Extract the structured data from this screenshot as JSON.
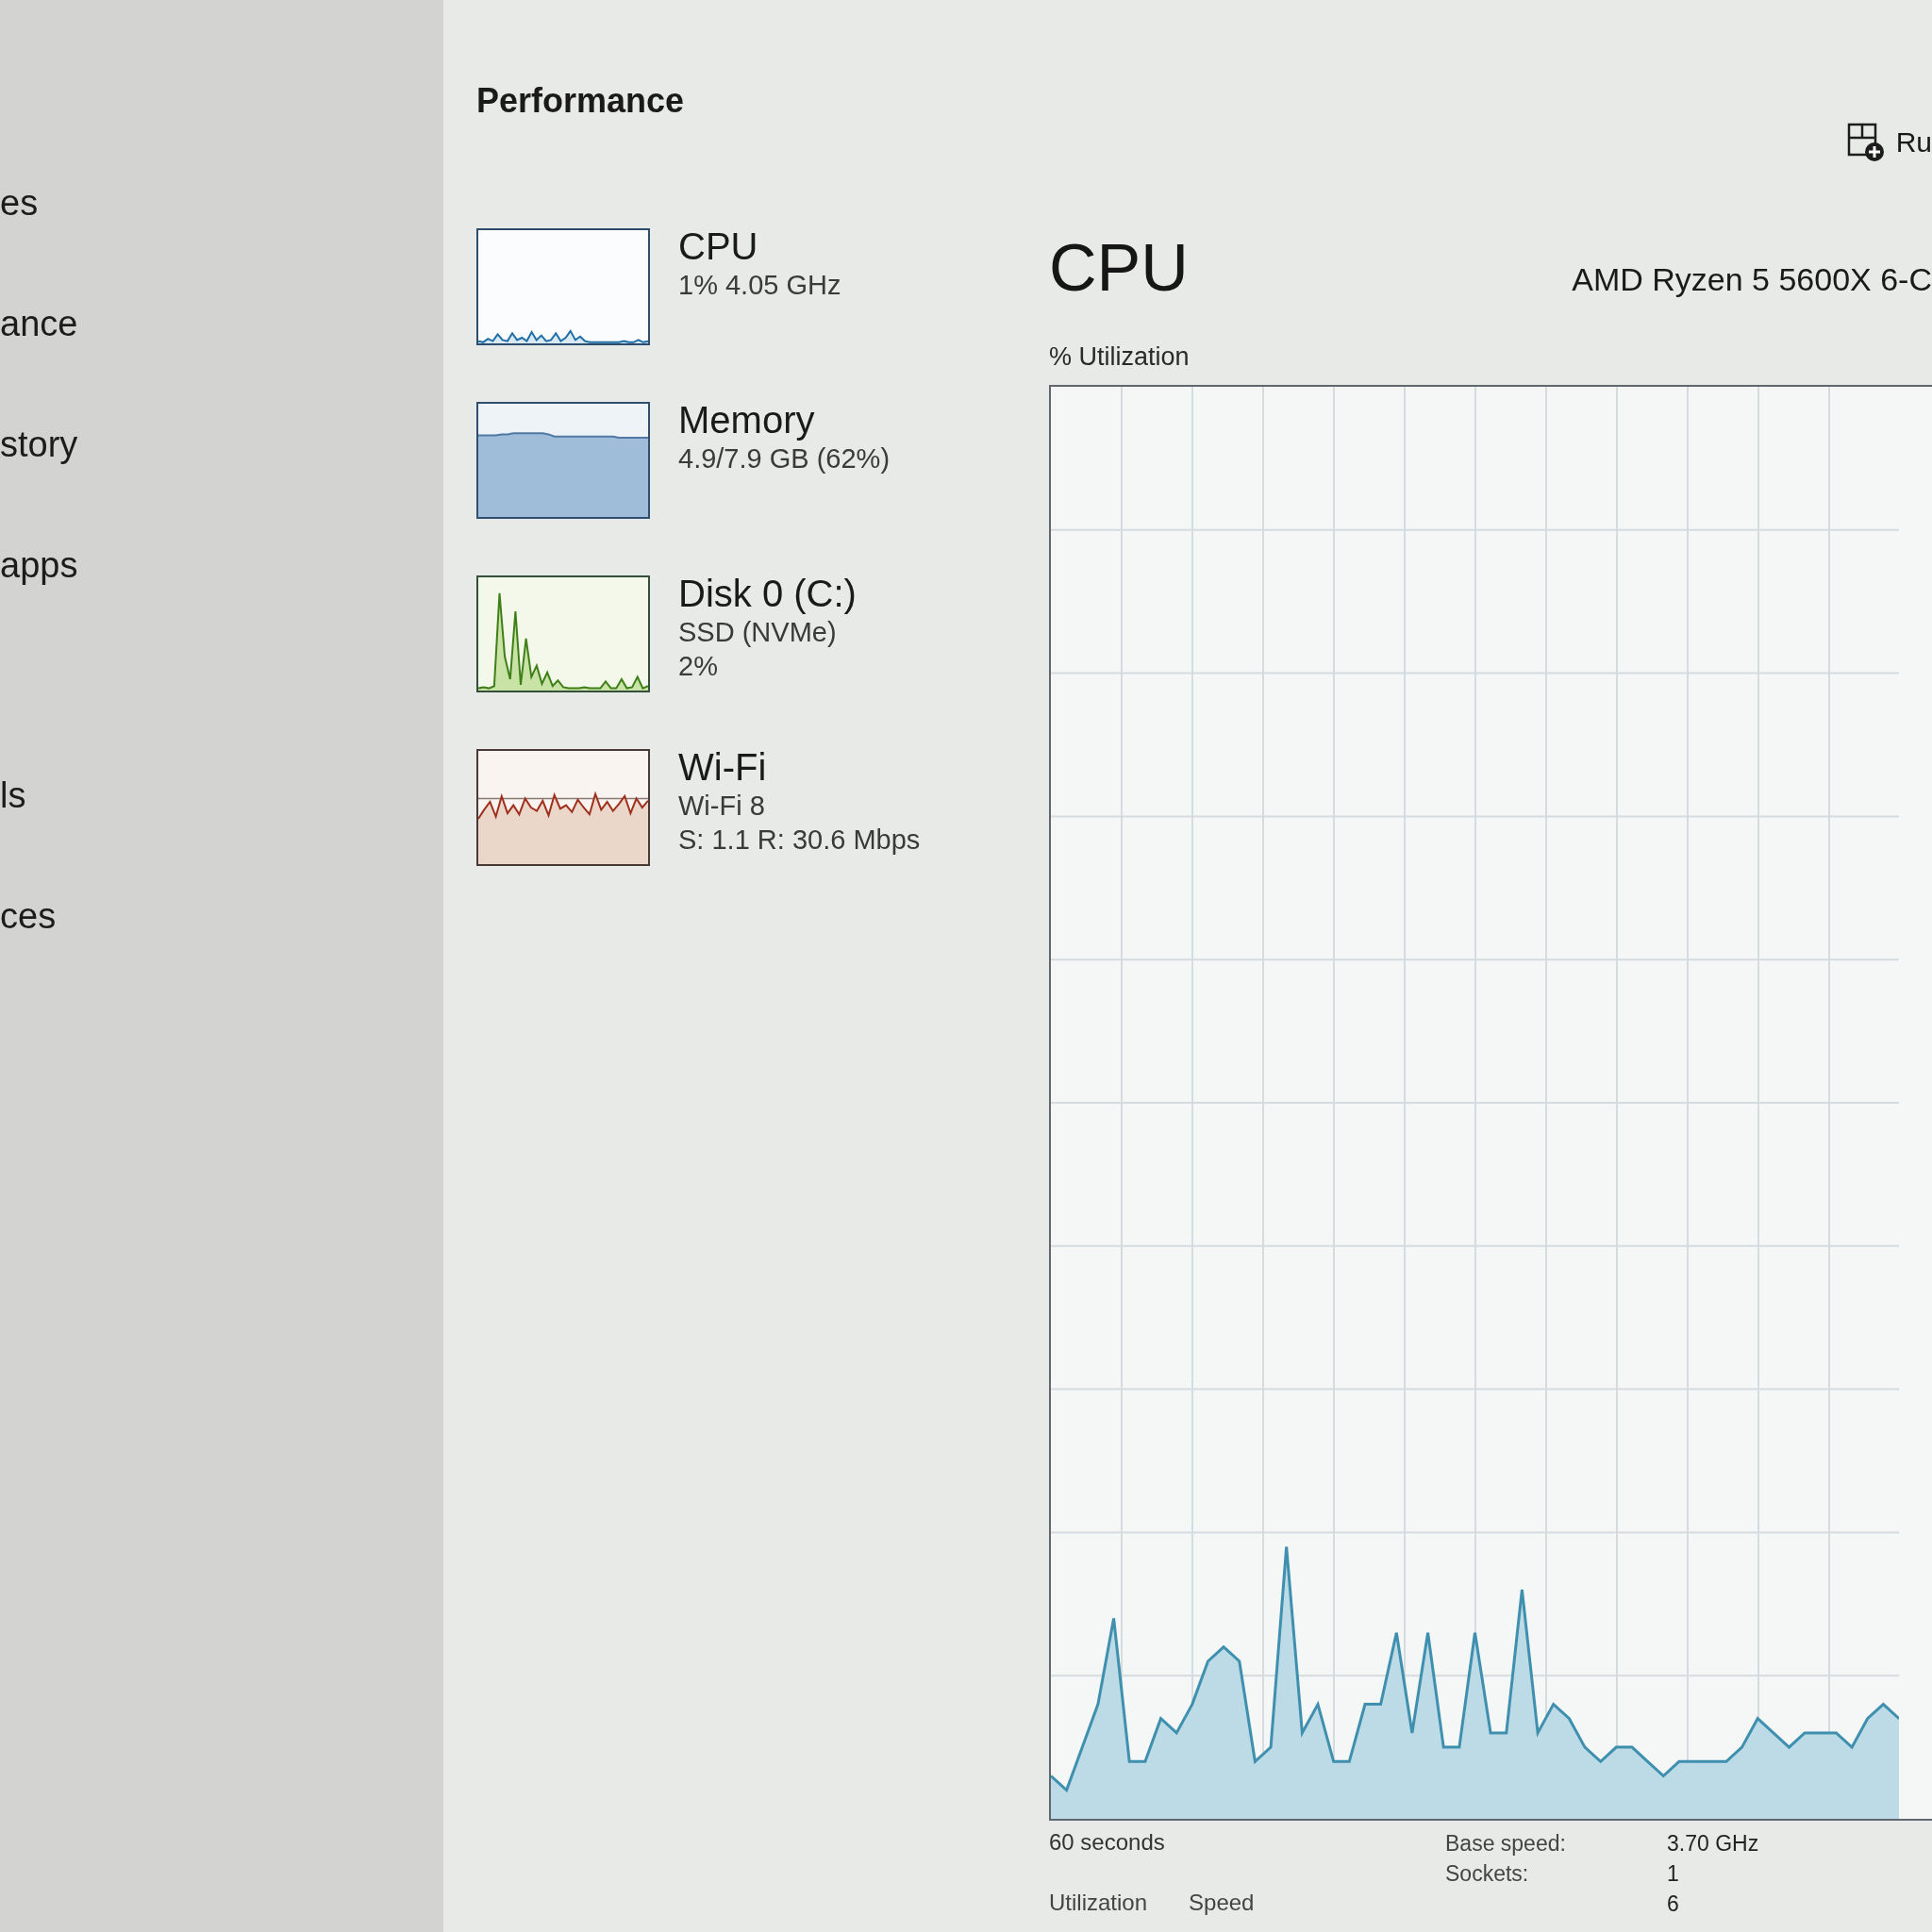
{
  "sidebar": {
    "items": [
      {
        "label": "es"
      },
      {
        "label": "ance"
      },
      {
        "label": "story"
      },
      {
        "label": "apps"
      },
      {
        "label": "ls"
      },
      {
        "label": "ces"
      }
    ]
  },
  "header": {
    "title": "Performance",
    "toolbar": [
      {
        "label": "Ru"
      }
    ]
  },
  "resources": [
    {
      "kind": "cpu",
      "name": "CPU",
      "details": [
        "1% 4.05 GHz"
      ]
    },
    {
      "kind": "memory",
      "name": "Memory",
      "details": [
        "4.9/7.9 GB (62%)"
      ]
    },
    {
      "kind": "disk",
      "name": "Disk 0 (C:)",
      "details": [
        "SSD (NVMe)",
        "2%"
      ]
    },
    {
      "kind": "network",
      "name": "Wi-Fi",
      "details": [
        "Wi-Fi 8",
        "S: 1.1 R: 30.6 Mbps"
      ]
    }
  ],
  "detail": {
    "title": "CPU",
    "model": "AMD Ryzen 5 5600X 6-C",
    "graph_label": "% Utilization",
    "time_span": "60 seconds",
    "stats": [
      {
        "label": "Utilization"
      },
      {
        "label": "Speed"
      }
    ],
    "specs": [
      {
        "label": "Base speed:",
        "value": "3.70 GHz"
      },
      {
        "label": "Sockets:",
        "value": "1"
      },
      {
        "value": "6"
      }
    ]
  }
}
